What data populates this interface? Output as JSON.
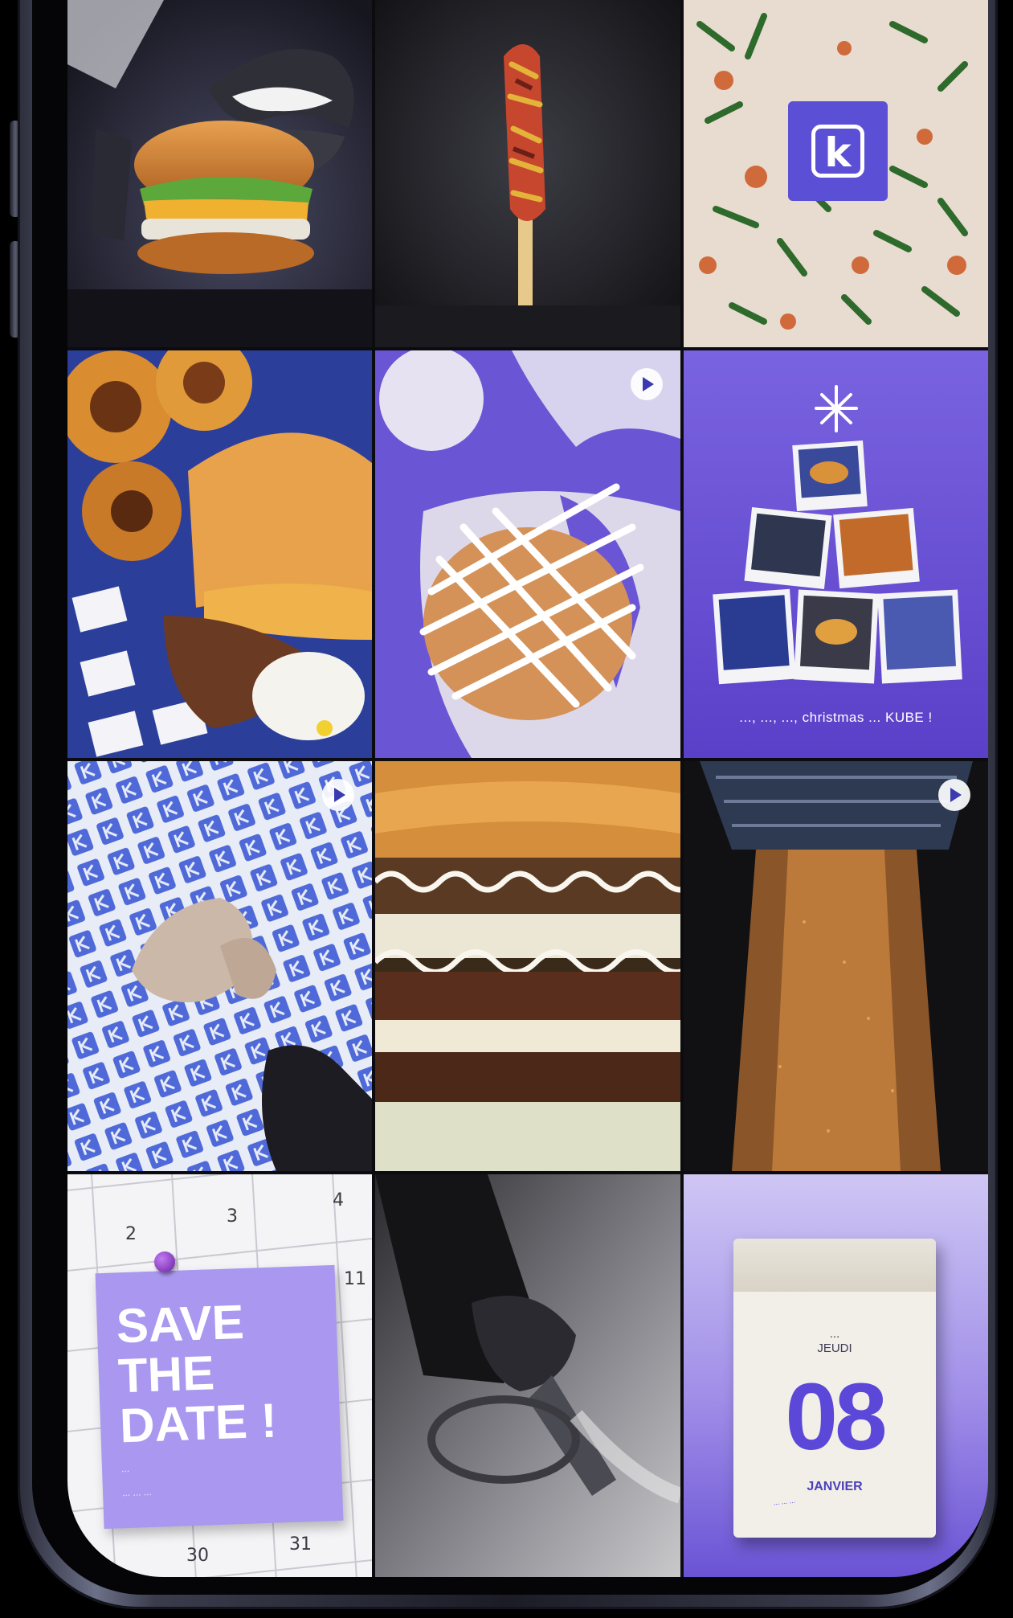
{
  "grid": {
    "tiles": [
      {
        "name": "tile-burger-lips",
        "video": false
      },
      {
        "name": "tile-corn-dog",
        "video": false
      },
      {
        "name": "tile-pizza-logo",
        "video": false,
        "logo_glyph": "k"
      },
      {
        "name": "tile-burger-onion-rings",
        "video": false
      },
      {
        "name": "tile-sauce-drizzle",
        "video": true
      },
      {
        "name": "tile-christmas-polaroids",
        "video": false,
        "caption": "..., ..., ..., christmas ... KUBE !"
      },
      {
        "name": "tile-patterned-paper-sauce",
        "video": true
      },
      {
        "name": "tile-double-burger-closeup",
        "video": false
      },
      {
        "name": "tile-grinder-pour",
        "video": true
      },
      {
        "name": "tile-save-the-date",
        "video": false
      },
      {
        "name": "tile-grill-scrape",
        "video": false
      },
      {
        "name": "tile-tearoff-calendar",
        "video": false
      }
    ]
  },
  "save_the_date": {
    "title_line1": "SAVE",
    "title_line2": "THE",
    "title_line3": "DATE !",
    "subtitle_line1": "...",
    "subtitle_line2": "... ... ...",
    "calendar_numbers": [
      "2",
      "3",
      "4",
      "11",
      "30",
      "31"
    ]
  },
  "tearoff_calendar": {
    "day_line1": "...",
    "day_line2": "JEUDI",
    "number": "08",
    "month": "JANVIER",
    "note": "... ... ..."
  },
  "icons": {
    "video": "video-play-icon",
    "logo": "k-logo-icon",
    "star": "sparkle-icon",
    "pin": "pushpin-icon"
  },
  "colors": {
    "brand_purple": "#5b47d8",
    "lilac": "#a997f0",
    "phone_frame": "#3a3c4c",
    "background": "#000000"
  }
}
